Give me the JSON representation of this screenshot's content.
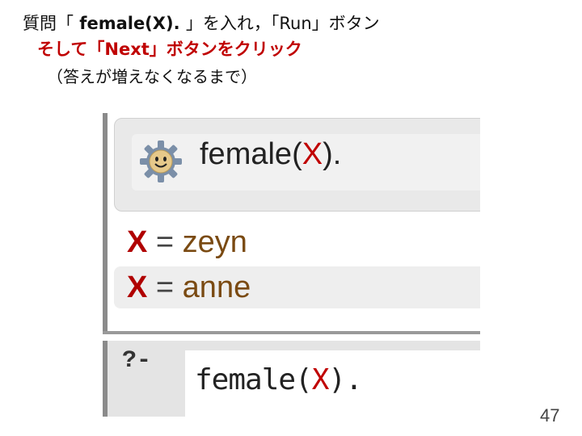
{
  "instruction": {
    "line1_pre": "質問「",
    "line1_query": " female(X). ",
    "line1_post": "」を入れ，「Run」ボタン",
    "line2": "そして「Next」ボタンをクリック",
    "line3": "（答えが増えなくなるまで）"
  },
  "screenshot": {
    "query_name": "female",
    "query_open": "(",
    "query_var": "X",
    "query_close": ").",
    "answers": [
      {
        "var": "X",
        "eq": " = ",
        "value": "zeyn"
      },
      {
        "var": "X",
        "eq": " = ",
        "value": "anne"
      }
    ],
    "prompt": "?-",
    "input_name": "female",
    "input_open": "(",
    "input_var": "X",
    "input_close": ")."
  },
  "page_number": "47",
  "colors": {
    "accent_red": "#c00000",
    "value_brown": "#7a4a12"
  }
}
